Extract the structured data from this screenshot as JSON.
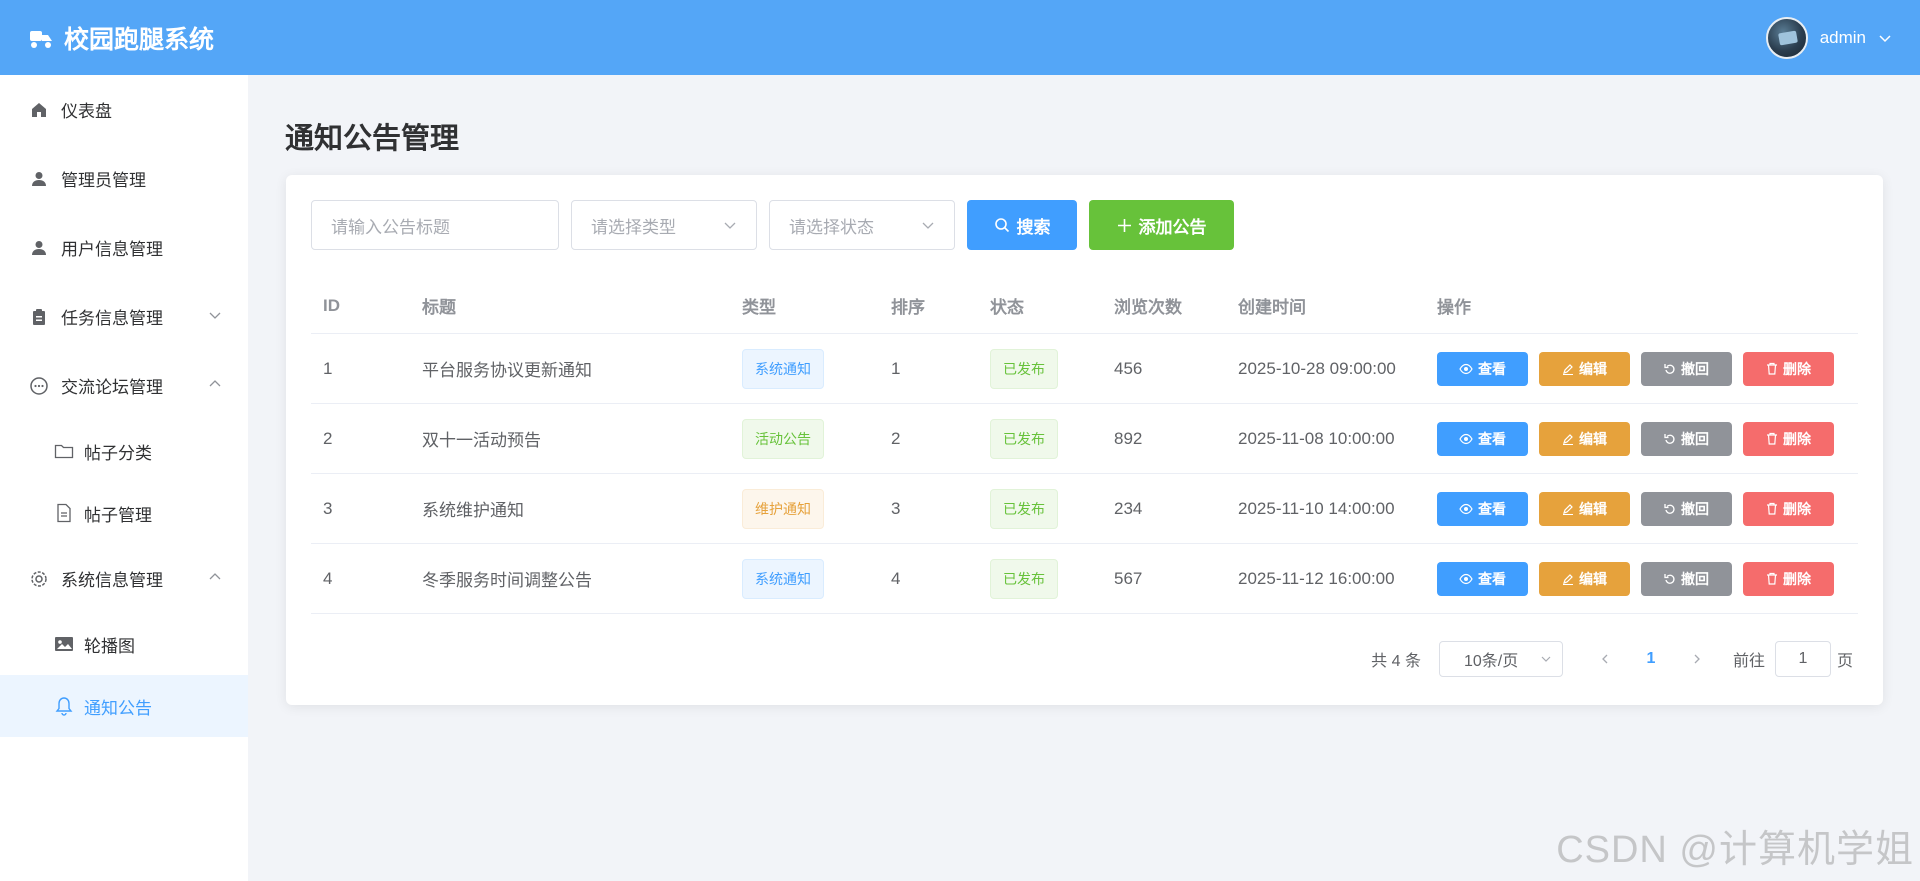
{
  "app": {
    "title": "校园跑腿系统",
    "user_name": "admin"
  },
  "sidebar": {
    "items": [
      {
        "label": "仪表盘",
        "icon": "home-icon"
      },
      {
        "label": "管理员管理",
        "icon": "user-icon"
      },
      {
        "label": "用户信息管理",
        "icon": "user-icon"
      },
      {
        "label": "任务信息管理",
        "icon": "clipboard-icon",
        "expanded": false
      },
      {
        "label": "交流论坛管理",
        "icon": "chat-icon",
        "expanded": true
      },
      {
        "label": "帖子分类",
        "icon": "folder-icon"
      },
      {
        "label": "帖子管理",
        "icon": "document-icon"
      },
      {
        "label": "系统信息管理",
        "icon": "gear-icon",
        "expanded": true
      },
      {
        "label": "轮播图",
        "icon": "picture-icon"
      },
      {
        "label": "通知公告",
        "icon": "bell-icon",
        "active": true
      }
    ]
  },
  "page": {
    "title": "通知公告管理"
  },
  "filters": {
    "title_placeholder": "请输入公告标题",
    "type_placeholder": "请选择类型",
    "status_placeholder": "请选择状态",
    "search_label": "搜索",
    "add_label": "添加公告"
  },
  "table": {
    "headers": {
      "id": "ID",
      "title": "标题",
      "type": "类型",
      "sort": "排序",
      "status": "状态",
      "views": "浏览次数",
      "created": "创建时间",
      "ops": "操作"
    },
    "rows": [
      {
        "id": "1",
        "title": "平台服务协议更新通知",
        "type": "系统通知",
        "type_color": "#409eff",
        "sort": "1",
        "status": "已发布",
        "views": "456",
        "created": "2025-10-28 09:00:00"
      },
      {
        "id": "2",
        "title": "双十一活动预告",
        "type": "活动公告",
        "type_color": "#67c23a",
        "sort": "2",
        "status": "已发布",
        "views": "892",
        "created": "2025-11-08 10:00:00"
      },
      {
        "id": "3",
        "title": "系统维护通知",
        "type": "维护通知",
        "type_color": "#e6a23c",
        "sort": "3",
        "status": "已发布",
        "views": "234",
        "created": "2025-11-10 14:00:00"
      },
      {
        "id": "4",
        "title": "冬季服务时间调整公告",
        "type": "系统通知",
        "type_color": "#409eff",
        "sort": "4",
        "status": "已发布",
        "views": "567",
        "created": "2025-11-12 16:00:00"
      }
    ],
    "ops": {
      "view": "查看",
      "edit": "编辑",
      "revoke": "撤回",
      "delete": "删除"
    }
  },
  "pagination": {
    "total": "共 4 条",
    "page_size": "10条/页",
    "current": "1",
    "goto_prefix": "前往",
    "goto_value": "1",
    "goto_suffix": "页"
  },
  "watermark": "CSDN @计算机学姐",
  "colors": {
    "header": "#54a6f7",
    "primary": "#409eff",
    "success": "#67c23a",
    "warning": "#e6a23c",
    "info": "#909399",
    "danger": "#f56c6c"
  }
}
